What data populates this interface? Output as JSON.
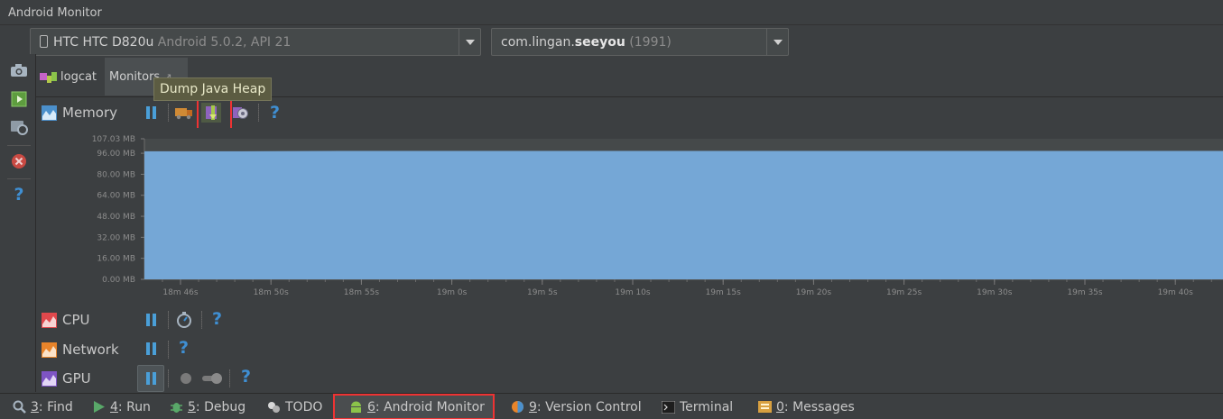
{
  "window": {
    "title": "Android Monitor"
  },
  "device_selector": {
    "device": "HTC HTC D820u",
    "os": "Android 5.0.2, API 21"
  },
  "process_selector": {
    "prefix": "com.lingan.",
    "bold": "seeyou",
    "pid": "(1991)"
  },
  "tabs": [
    {
      "label": "logcat",
      "icon": "android-logcat-icon"
    },
    {
      "label": "Monitors",
      "icon": "pin-icon"
    }
  ],
  "tooltip": "Dump Java Heap",
  "sections": {
    "memory": {
      "label": "Memory",
      "color": "#4b90cc"
    },
    "cpu": {
      "label": "CPU",
      "color": "#e0484c"
    },
    "network": {
      "label": "Network",
      "color": "#e8842a"
    },
    "gpu": {
      "label": "GPU",
      "color": "#7e54c4"
    }
  },
  "chart_data": {
    "type": "area",
    "title": "",
    "xlabel": "",
    "ylabel": "",
    "ylim": [
      0,
      107.03
    ],
    "y_ticks": [
      "107.03 MB",
      "96.00 MB",
      "80.00 MB",
      "64.00 MB",
      "48.00 MB",
      "32.00 MB",
      "16.00 MB",
      "0.00 MB"
    ],
    "y_tick_values": [
      107.03,
      96,
      80,
      64,
      48,
      32,
      16,
      0
    ],
    "x_ticks": [
      "18m 46s",
      "18m 50s",
      "18m 55s",
      "19m 0s",
      "19m 5s",
      "19m 10s",
      "19m 15s",
      "19m 20s",
      "19m 25s",
      "19m 30s",
      "19m 35s",
      "19m 40s"
    ],
    "series": [
      {
        "values": [
          97.5,
          97.5,
          97.8,
          97.8,
          97.8,
          97.8,
          97.8,
          97.8,
          97.8,
          97.8,
          97.8,
          97.8
        ],
        "color": "#75a7d6"
      }
    ],
    "grid": false
  },
  "status_bar": [
    {
      "key": "3",
      "label": ": Find",
      "icon": "search-icon"
    },
    {
      "key": "4",
      "label": ": Run",
      "icon": "run-icon"
    },
    {
      "key": "5",
      "label": ": Debug",
      "icon": "debug-icon"
    },
    {
      "key": "",
      "label": "TODO",
      "icon": "todo-icon"
    },
    {
      "key": "6",
      "label": ": Android Monitor",
      "icon": "android-icon"
    },
    {
      "key": "9",
      "label": ": Version Control",
      "icon": "version-control-icon"
    },
    {
      "key": "",
      "label": "Terminal",
      "icon": "terminal-icon"
    },
    {
      "key": "0",
      "label": ": Messages",
      "icon": "messages-icon"
    }
  ]
}
